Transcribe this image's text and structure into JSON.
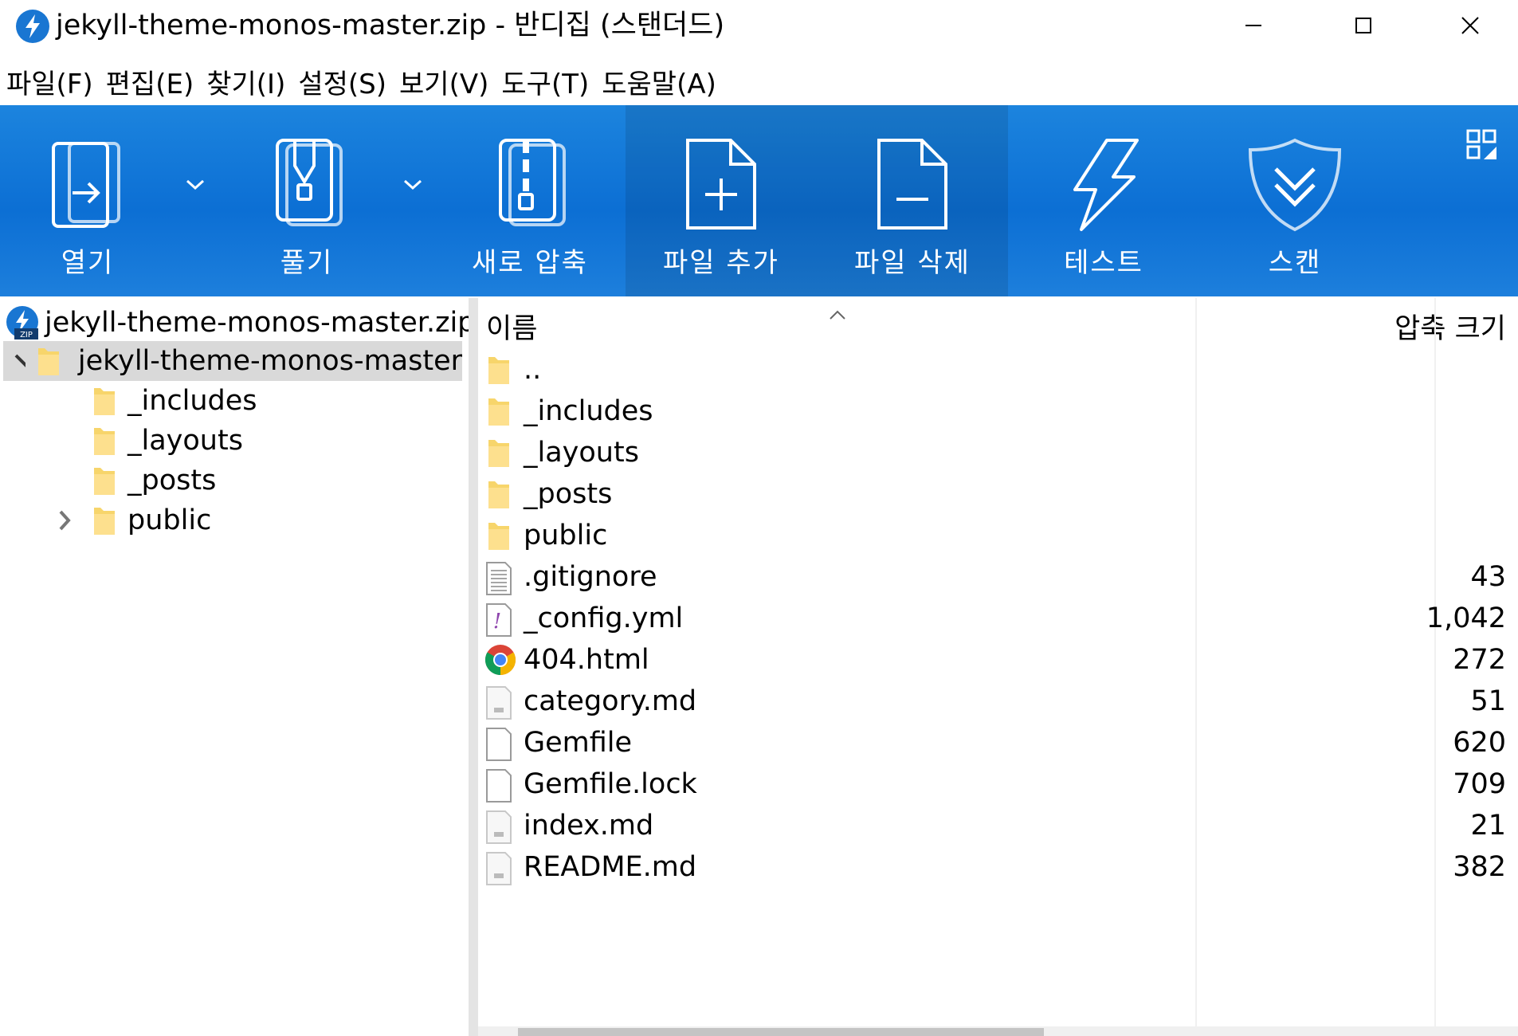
{
  "window": {
    "title": "jekyll-theme-monos-master.zip  -  반디집 (스탠더드)"
  },
  "menu": [
    "파일(F)",
    "편집(E)",
    "찾기(I)",
    "설정(S)",
    "보기(V)",
    "도구(T)",
    "도움말(A)"
  ],
  "toolbar": {
    "open": "열기",
    "extract": "풀기",
    "new_archive": "새로 압축",
    "add_files": "파일 추가",
    "delete_files": "파일 삭제",
    "test": "테스트",
    "scan": "스캔"
  },
  "tree": {
    "archive": "jekyll-theme-monos-master.zip",
    "root": "jekyll-theme-monos-master",
    "children": [
      "_includes",
      "_layouts",
      "_posts",
      "public"
    ]
  },
  "list": {
    "col_name": "이름",
    "col_size": "압축 크기",
    "files": [
      {
        "name": "..",
        "size": "",
        "icon": "folder-icon"
      },
      {
        "name": "_includes",
        "size": "",
        "icon": "folder-icon"
      },
      {
        "name": "_layouts",
        "size": "",
        "icon": "folder-icon"
      },
      {
        "name": "_posts",
        "size": "",
        "icon": "folder-icon"
      },
      {
        "name": "public",
        "size": "",
        "icon": "folder-icon"
      },
      {
        "name": ".gitignore",
        "size": "43",
        "icon": "text-file-icon"
      },
      {
        "name": "_config.yml",
        "size": "1,042",
        "icon": "yml-file-icon"
      },
      {
        "name": "404.html",
        "size": "272",
        "icon": "chrome-icon"
      },
      {
        "name": "category.md",
        "size": "51",
        "icon": "md-file-icon"
      },
      {
        "name": "Gemfile",
        "size": "620",
        "icon": "blank-file-icon"
      },
      {
        "name": "Gemfile.lock",
        "size": "709",
        "icon": "blank-file-icon"
      },
      {
        "name": "index.md",
        "size": "21",
        "icon": "md-file-icon"
      },
      {
        "name": "README.md",
        "size": "382",
        "icon": "md-file-icon"
      }
    ]
  },
  "colors": {
    "toolbar_blue": "#0c6fd4",
    "folder_yellow": "#f7d56b",
    "selection_gray": "#d9d9d9"
  }
}
